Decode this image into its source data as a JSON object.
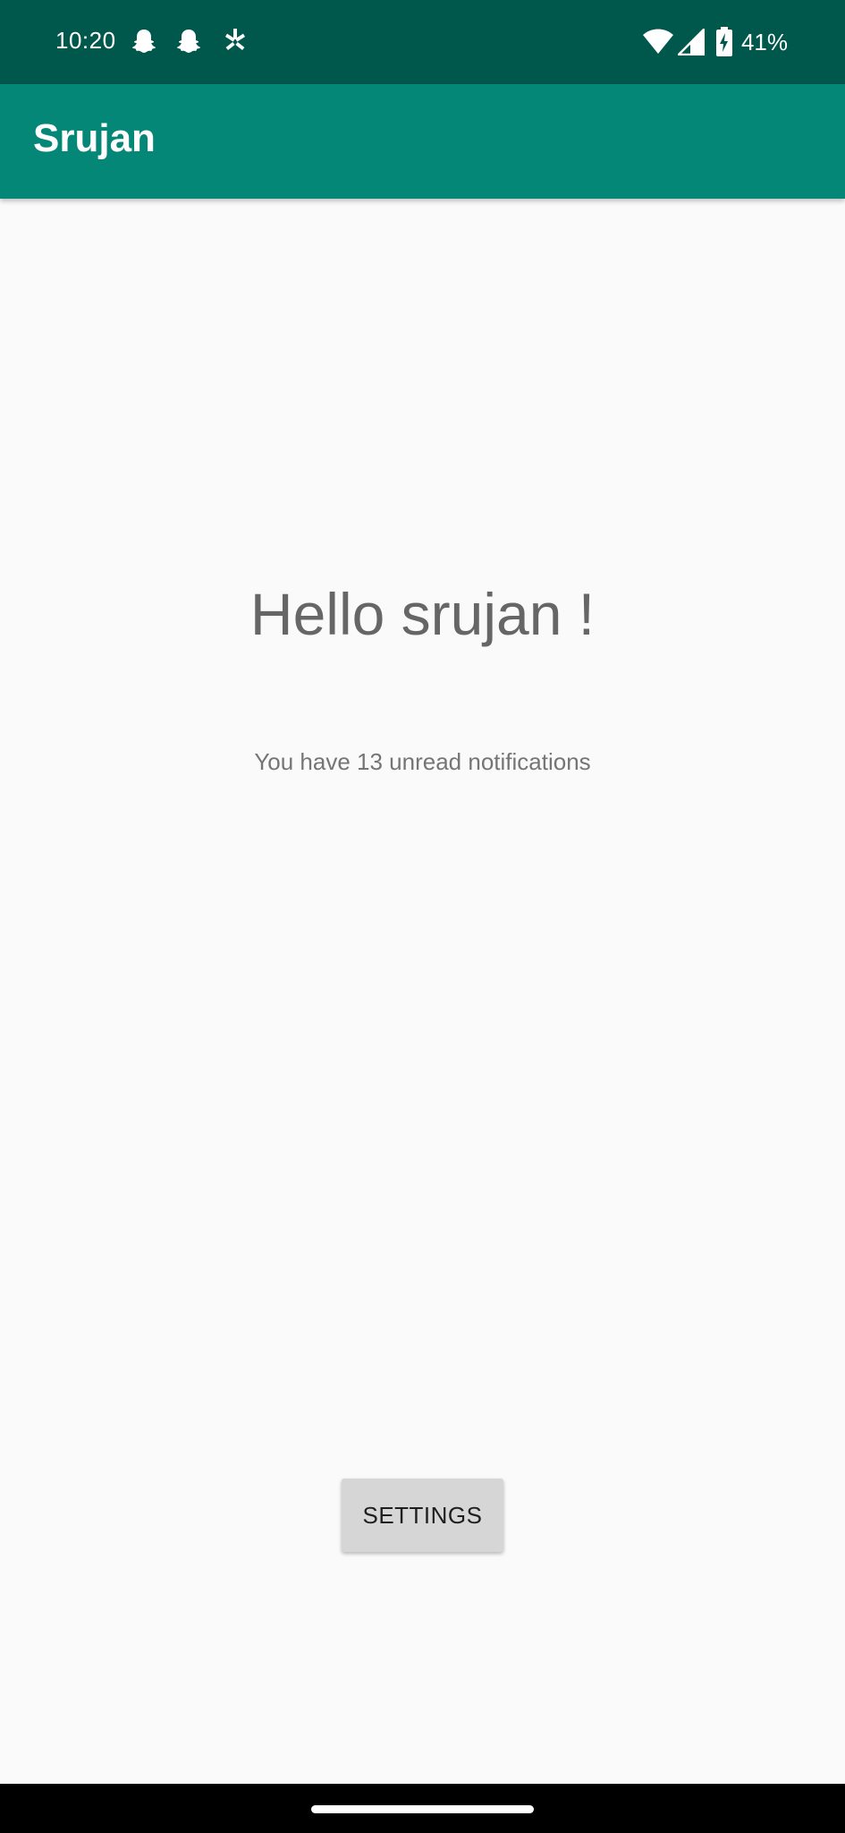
{
  "status_bar": {
    "time": "10:20",
    "battery_percent": "41%",
    "background_color": "#00574b",
    "icons": [
      "snapchat-icon",
      "snapchat-icon",
      "yelp-icon",
      "wifi-icon",
      "cellular-signal-icon",
      "battery-charging-icon"
    ]
  },
  "app_bar": {
    "title": "Srujan",
    "background_color": "#058777"
  },
  "main": {
    "greeting": "Hello srujan !",
    "notification_text": "You have 13 unread notifications",
    "settings_label": "SETTINGS"
  }
}
